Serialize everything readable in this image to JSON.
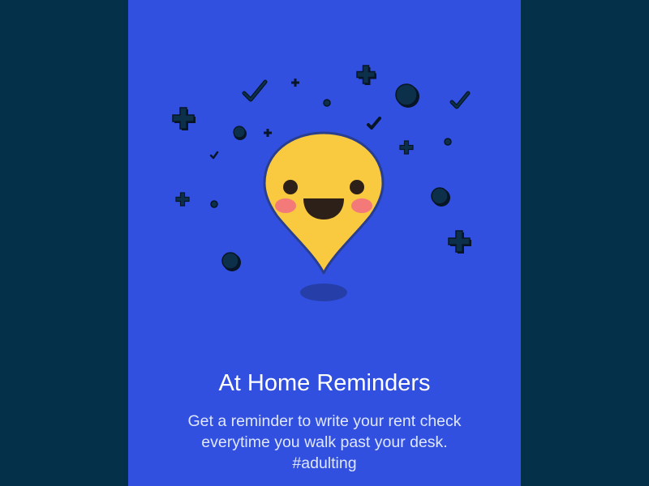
{
  "colors": {
    "background": "#04304a",
    "panel": "#3150e0",
    "pin": "#f9c93f",
    "pin_outline": "#2a3e8f",
    "cheek": "#f47a7a",
    "face_features": "#2d2018",
    "decor_fill": "#0c3049",
    "title_text": "#ffffff",
    "body_text": "#dfe6ff"
  },
  "illustration": {
    "name": "smiling-location-pin",
    "decorations": [
      "plus-icon",
      "check-icon",
      "dot-icon"
    ]
  },
  "card": {
    "title": "At Home Reminders",
    "description_lines": [
      "Get a reminder to write your rent check",
      "everytime you walk past your desk.",
      "#adulting"
    ]
  }
}
